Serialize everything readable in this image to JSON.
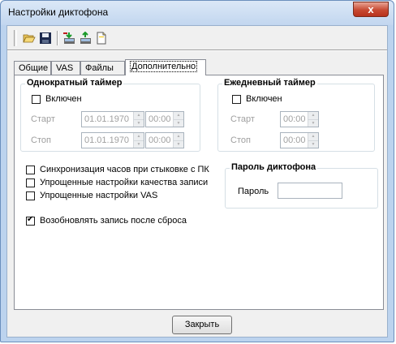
{
  "window": {
    "title": "Настройки диктофона",
    "close_glyph": "x"
  },
  "toolbar": {
    "buttons": [
      {
        "name": "open-folder-icon"
      },
      {
        "name": "save-icon"
      },
      {
        "name": "import-icon"
      },
      {
        "name": "export-icon"
      },
      {
        "name": "new-document-icon"
      }
    ]
  },
  "tabs": [
    "Общие",
    "VAS",
    "Файлы",
    "Дополнительно"
  ],
  "active_tab": "Дополнительно",
  "once_timer": {
    "title": "Однократный таймер",
    "enabled_label": "Включен",
    "enabled": false,
    "start_label": "Старт",
    "start_date": "01.01.1970",
    "start_time": "00:00",
    "stop_label": "Стоп",
    "stop_date": "01.01.1970",
    "stop_time": "00:00"
  },
  "daily_timer": {
    "title": "Ежедневный таймер",
    "enabled_label": "Включен",
    "enabled": false,
    "start_label": "Старт",
    "start_time": "00:00",
    "stop_label": "Стоп",
    "stop_time": "00:00"
  },
  "options": {
    "sync_clock": {
      "label": "Синхронизация часов при стыковке с ПК",
      "checked": false
    },
    "simple_quality": {
      "label": "Упрощенные настройки качества записи",
      "checked": false
    },
    "simple_vas": {
      "label": "Упрощенные настройки VAS",
      "checked": false
    },
    "resume_after_reset": {
      "label": "Возобновлять запись после сброса",
      "checked": true
    }
  },
  "password": {
    "title": "Пароль диктофона",
    "label": "Пароль",
    "value": ""
  },
  "close_button": "Закрыть",
  "colors": {
    "title_bg": "#c2d6ef",
    "close_red": "#c74a32",
    "disabled_text": "#a0a0a0"
  }
}
